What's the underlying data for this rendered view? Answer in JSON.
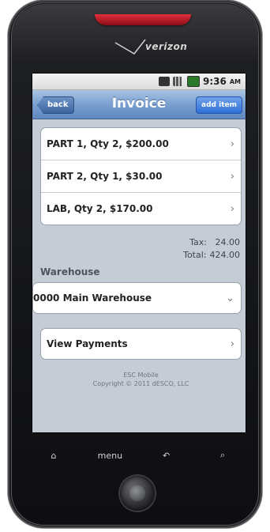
{
  "device": {
    "carrier": "verizon"
  },
  "statusbar": {
    "time": "9:36",
    "ampm": "AM"
  },
  "navbar": {
    "back_label": "back",
    "title": "Invoice",
    "add_label": "add item"
  },
  "items": [
    {
      "label": "PART 1, Qty 2, $200.00"
    },
    {
      "label": "PART 2, Qty 1, $30.00"
    },
    {
      "label": "LAB, Qty 2, $170.00"
    }
  ],
  "totals": {
    "tax_label": "Tax:",
    "tax_value": "24.00",
    "total_label": "Total:",
    "total_value": "424.00"
  },
  "warehouse": {
    "section_label": "Warehouse",
    "selected": "0000 Main Warehouse"
  },
  "payments": {
    "label": "View Payments"
  },
  "footer": {
    "line1": "ESC Mobile",
    "line2": "Copyright © 2011 dESCO, LLC"
  },
  "hardware_keys": [
    "home-icon",
    "menu",
    "back-arrow-icon",
    "search-icon"
  ],
  "hardware_menu_label": "menu",
  "colors": {
    "nav_blue": "#7aa0d0",
    "add_button_blue": "#2f6fd6",
    "speaker_red": "#c01a24"
  }
}
